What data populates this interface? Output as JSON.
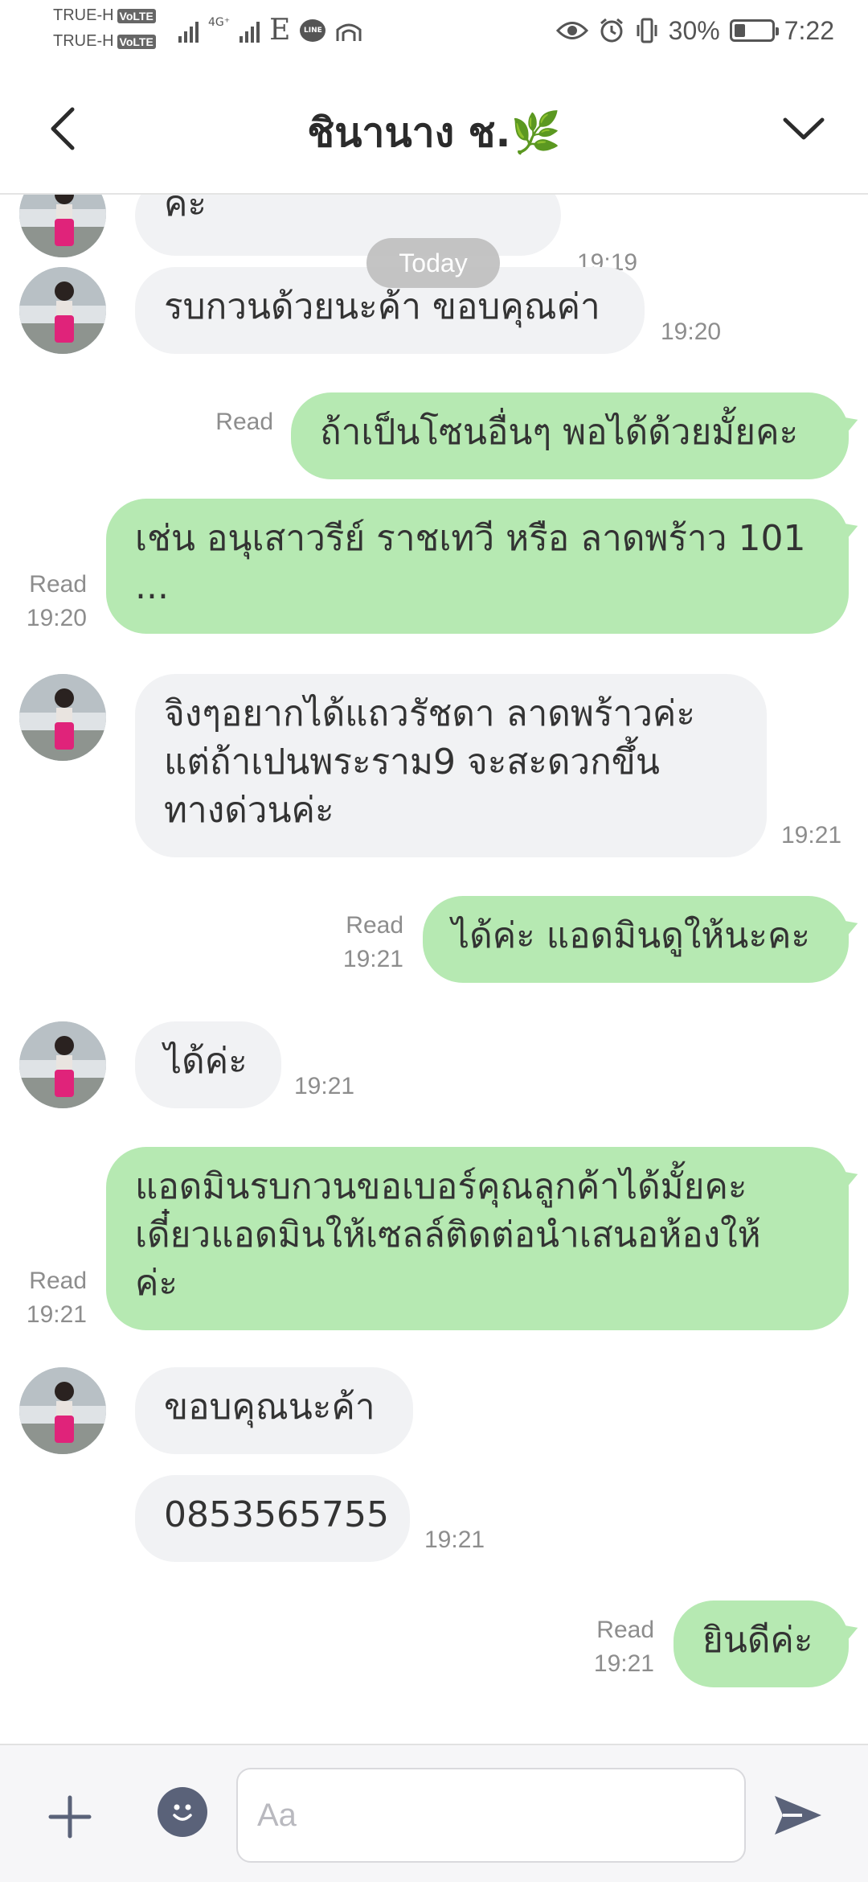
{
  "status_bar": {
    "carrier_1": "TRUE-H",
    "carrier_2": "TRUE-H",
    "volte": "VoLTE",
    "network_4g": "4G⁺",
    "network_e": "E",
    "line_icon_text": "LINE",
    "battery_percent": "30%",
    "battery_level": 0.3,
    "time": "7:22"
  },
  "header": {
    "title": "ชินานาง ช.🌿"
  },
  "chat": {
    "date_pill": "Today",
    "messages": [
      {
        "side": "in",
        "text": "ค่ะ",
        "time": "19:19"
      },
      {
        "side": "in",
        "text": "รบกวนด้วยนะค้า ขอบคุณค่า",
        "time": "19:20"
      },
      {
        "side": "out",
        "text": "ถ้าเป็นโซนอื่นๆ พอได้ด้วยมั้ยคะ",
        "read": "Read",
        "time": ""
      },
      {
        "side": "out",
        "text": "เช่น อนุเสาวรีย์ ราชเทวี หรือ ลาดพร้าว 101\n...",
        "read": "Read",
        "time": "19:20"
      },
      {
        "side": "in",
        "text": "จิงๆอยากได้แถวรัชดา ลาดพร้าวค่ะ\nแต่ถ้าเปนพระราม9 จะสะดวกขึ้น\nทางด่วนค่ะ",
        "time": "19:21"
      },
      {
        "side": "out",
        "text": "ได้ค่ะ แอดมินดูให้นะคะ",
        "read": "Read",
        "time": "19:21"
      },
      {
        "side": "in",
        "text": "ได้ค่ะ",
        "time": "19:21"
      },
      {
        "side": "out",
        "text": "แอดมินรบกวนขอเบอร์คุณลูกค้าได้มั้ยคะ\nเดี๋ยวแอดมินให้เซลล์ติดต่อนำเสนอห้องให้\nค่ะ",
        "read": "Read",
        "time": "19:21"
      },
      {
        "side": "in",
        "text": "ขอบคุณนะค้า",
        "time": ""
      },
      {
        "side": "in",
        "text": "0853565755",
        "time": "19:21"
      },
      {
        "side": "out",
        "text": "ยินดีค่ะ",
        "read": "Read",
        "time": "19:21"
      }
    ]
  },
  "input_bar": {
    "placeholder": "Aa"
  },
  "colors": {
    "incoming_bubble": "#f1f2f4",
    "outgoing_bubble": "#b6e9b2",
    "meta_text": "#8d8d8d",
    "icon_dark": "#5a6279"
  }
}
